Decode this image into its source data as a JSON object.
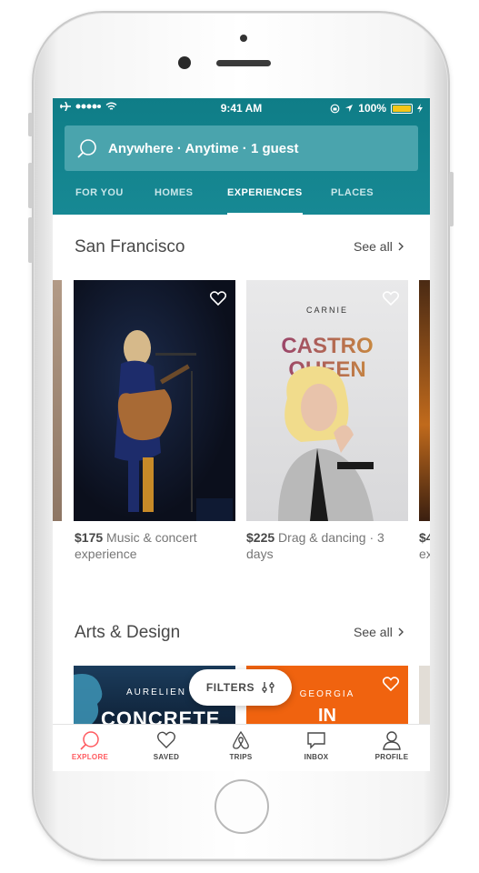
{
  "status_bar": {
    "time": "9:41 AM",
    "battery": "100%",
    "icons": [
      "airplane-icon",
      "signal-icon",
      "wifi-icon",
      "lock-rotation-icon",
      "location-icon",
      "battery-icon"
    ]
  },
  "search": {
    "text": "Anywhere · Anytime · 1 guest",
    "icon": "search-icon"
  },
  "tabs": [
    {
      "label": "FOR YOU"
    },
    {
      "label": "HOMES"
    },
    {
      "label": "EXPERIENCES",
      "active": true
    },
    {
      "label": "PLACES"
    }
  ],
  "sections": [
    {
      "title": "San Francisco",
      "see_all": "See all",
      "cards": [
        {
          "price": "$175",
          "title_line1": "Music & concert",
          "title_line2": "experience"
        },
        {
          "price": "$225",
          "title_line1": "Drag & dancing · 3",
          "title_line2": "days",
          "poster_small": "CARNIE",
          "poster_line1": "CASTRO",
          "poster_line2": "QUEEN"
        },
        {
          "price": "$4",
          "title_line2": "ex"
        }
      ]
    },
    {
      "title": "Arts & Design",
      "see_all": "See all",
      "cards": [
        {
          "poster_small": "AURELIEN",
          "poster_big": "CONCRETE"
        },
        {
          "poster_small": "GEORGIA",
          "poster_big": "IN"
        }
      ]
    }
  ],
  "filters_button": {
    "label": "FILTERS"
  },
  "bottom_nav": [
    {
      "label": "EXPLORE",
      "active": true
    },
    {
      "label": "SAVED"
    },
    {
      "label": "TRIPS"
    },
    {
      "label": "INBOX"
    },
    {
      "label": "PROFILE"
    }
  ],
  "colors": {
    "teal": "#137f89",
    "accent": "#ff5a5f",
    "text": "#484848"
  }
}
